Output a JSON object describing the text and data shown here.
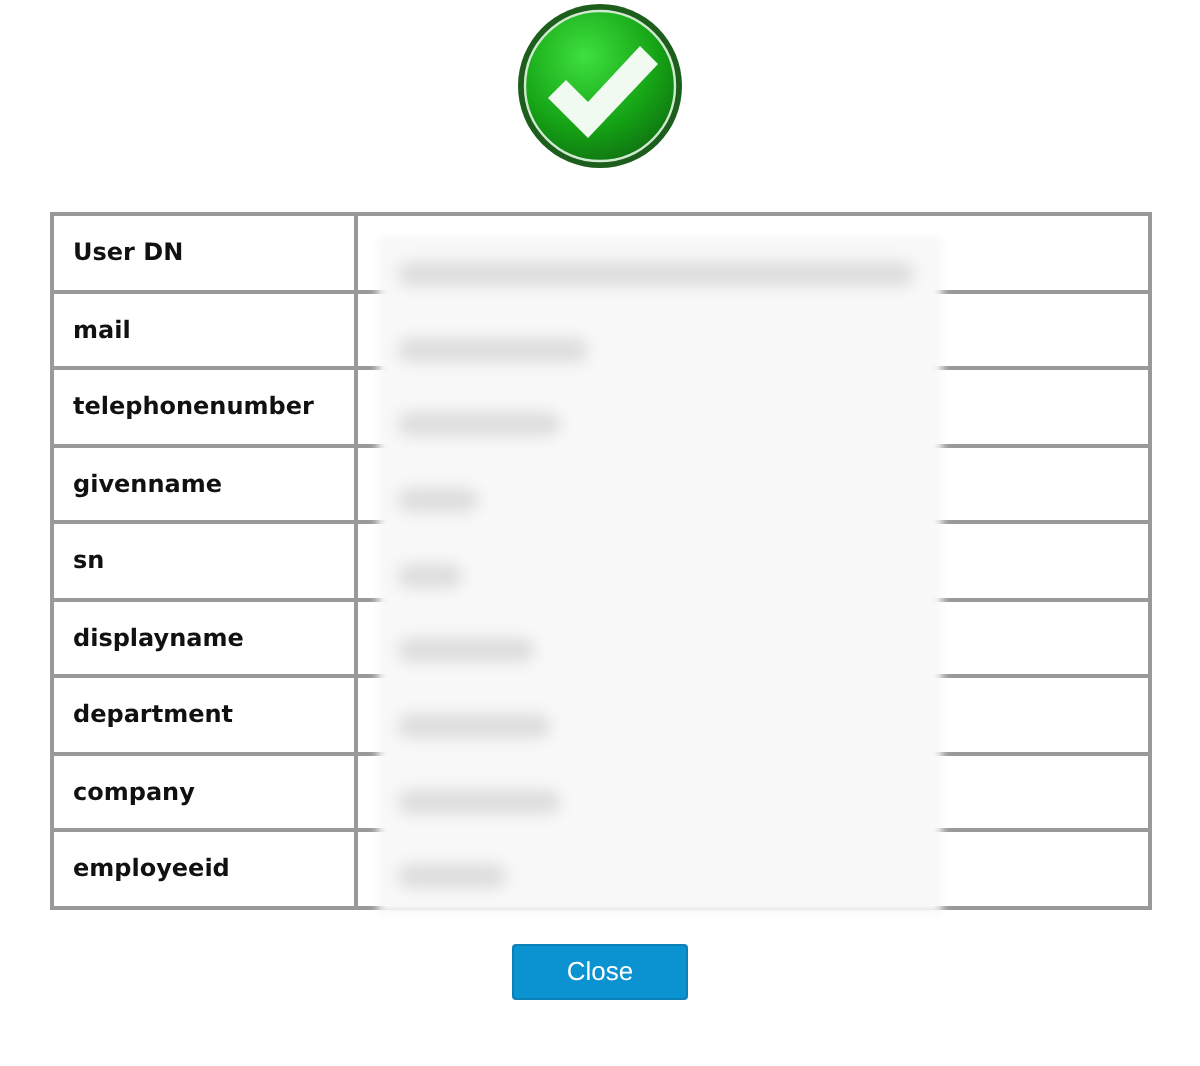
{
  "rows": [
    {
      "label": "User DN"
    },
    {
      "label": "mail"
    },
    {
      "label": "telephonenumber"
    },
    {
      "label": "givenname"
    },
    {
      "label": "sn"
    },
    {
      "label": "displayname"
    },
    {
      "label": "department"
    },
    {
      "label": "company"
    },
    {
      "label": "employeeid"
    }
  ],
  "buttons": [
    {
      "label": "Close",
      "kind": "primary"
    }
  ]
}
